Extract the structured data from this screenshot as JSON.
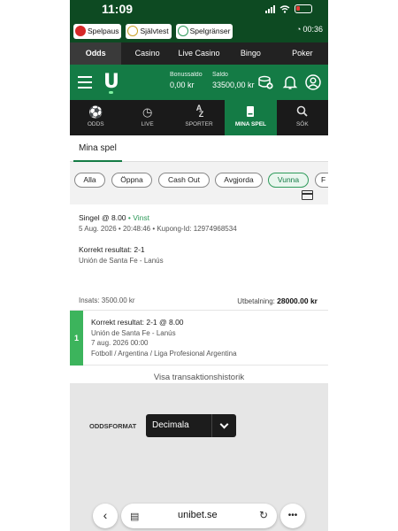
{
  "status_bar": {
    "time": "11:09"
  },
  "rg_bar": {
    "buttons": [
      "Spelpaus",
      "Självtest",
      "Spelgränser"
    ],
    "timer": "00:36"
  },
  "top_nav": [
    "Odds",
    "Casino",
    "Live Casino",
    "Bingo",
    "Poker"
  ],
  "header": {
    "logo": "U",
    "bonus_label": "Bonussaldo",
    "bonus_value": "0,00 kr",
    "saldo_label": "Saldo",
    "saldo_value": "33500,00 kr"
  },
  "sport_nav": [
    {
      "label": "ODDS",
      "icon": "soccer-ball-icon"
    },
    {
      "label": "LIVE",
      "icon": "clock-icon"
    },
    {
      "label": "SPORTER",
      "icon": "az-icon"
    },
    {
      "label": "MINA SPEL",
      "icon": "betslip-icon"
    },
    {
      "label": "SÖK",
      "icon": "search-icon"
    }
  ],
  "section": {
    "title": "Mina spel"
  },
  "filters": [
    "Alla",
    "Öppna",
    "Cash Out",
    "Avgjorda",
    "Vunna",
    "F"
  ],
  "active_filter": "Vunna",
  "bet": {
    "type": "Singel @ 8.00",
    "separator": " • ",
    "status": "Vinst",
    "status_color": "#2e9a5a",
    "meta": "5 Aug. 2026 • 20:48:46 • Kupong-Id: 12974968534",
    "market": "Korrekt resultat: 2-1",
    "event": "Unión de Santa Fe - Lanús",
    "stake": "Insats: 3500.00 kr",
    "payout_label": "Utbetalning:",
    "payout_value": "28000.00 kr"
  },
  "selection": {
    "number": "1",
    "market": "Korrekt resultat: 2-1 @ 8.00",
    "event": "Unión de Santa Fe - Lanús",
    "date": "7 aug. 2026 00:00",
    "league": "Fotboll / Argentina / Liga Profesional Argentina"
  },
  "history_link": "Visa transaktionshistorik",
  "odds_format": {
    "label": "ODDSFORMAT",
    "value": "Decimala"
  },
  "browser": {
    "url": "unibet.se",
    "more": "•••"
  },
  "colors": {
    "brand_green": "#147b45",
    "dark": "#1a1a1a",
    "win_green": "#3cb45c"
  }
}
